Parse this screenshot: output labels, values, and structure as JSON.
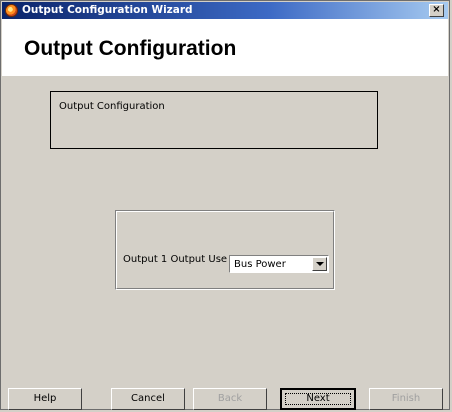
{
  "window": {
    "title": "Output Configuration Wizard",
    "close_label": "×"
  },
  "header": {
    "title": "Output Configuration"
  },
  "description": {
    "text": "Output Configuration"
  },
  "output_use": {
    "label": "Output 1 Output Use",
    "selected": "Bus Power"
  },
  "buttons": {
    "help": "Help",
    "cancel": "Cancel",
    "back": "Back",
    "next": "Next",
    "finish": "Finish"
  },
  "icons": {
    "title_icon": "app-logo-icon",
    "dropdown": "chevron-down-icon"
  }
}
